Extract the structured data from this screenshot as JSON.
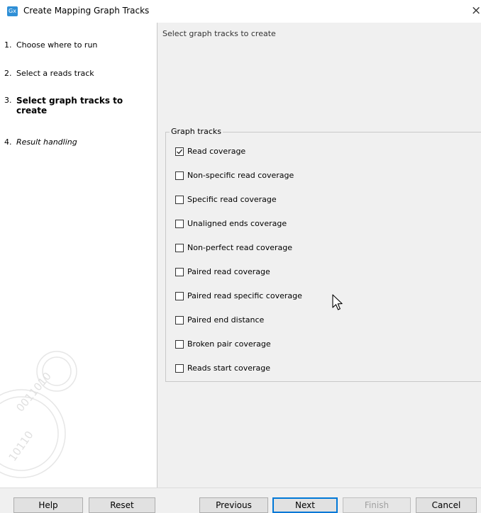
{
  "window": {
    "app_icon": "Gx",
    "title": "Create Mapping Graph Tracks",
    "close_glyph": "×"
  },
  "steps": [
    {
      "number": "1.",
      "label": "Choose where to run",
      "state": "normal"
    },
    {
      "number": "2.",
      "label": "Select a reads track",
      "state": "normal"
    },
    {
      "number": "3.",
      "label": "Select graph tracks to create",
      "state": "current"
    },
    {
      "number": "4.",
      "label": "Result handling",
      "state": "italic"
    }
  ],
  "content": {
    "title": "Select graph tracks to create",
    "group_label": "Graph tracks",
    "options": [
      {
        "label": "Read coverage",
        "checked": true
      },
      {
        "label": "Non-specific read coverage",
        "checked": false
      },
      {
        "label": "Specific read coverage",
        "checked": false
      },
      {
        "label": "Unaligned ends coverage",
        "checked": false
      },
      {
        "label": "Non-perfect read coverage",
        "checked": false
      },
      {
        "label": "Paired read coverage",
        "checked": false
      },
      {
        "label": "Paired read specific coverage",
        "checked": false
      },
      {
        "label": "Paired end distance",
        "checked": false
      },
      {
        "label": "Broken pair coverage",
        "checked": false
      },
      {
        "label": "Reads start coverage",
        "checked": false
      }
    ]
  },
  "buttons": {
    "help": "Help",
    "reset": "Reset",
    "previous": "Previous",
    "next": "Next",
    "finish": "Finish",
    "cancel": "Cancel"
  },
  "colors": {
    "accent": "#0078d7",
    "icon_bg": "#2f8fd6",
    "disabled_text": "#a0a0a0"
  },
  "icons": [
    "app-icon",
    "close-icon",
    "checkmark-icon",
    "mouse-cursor-icon",
    "binary-watermark"
  ]
}
